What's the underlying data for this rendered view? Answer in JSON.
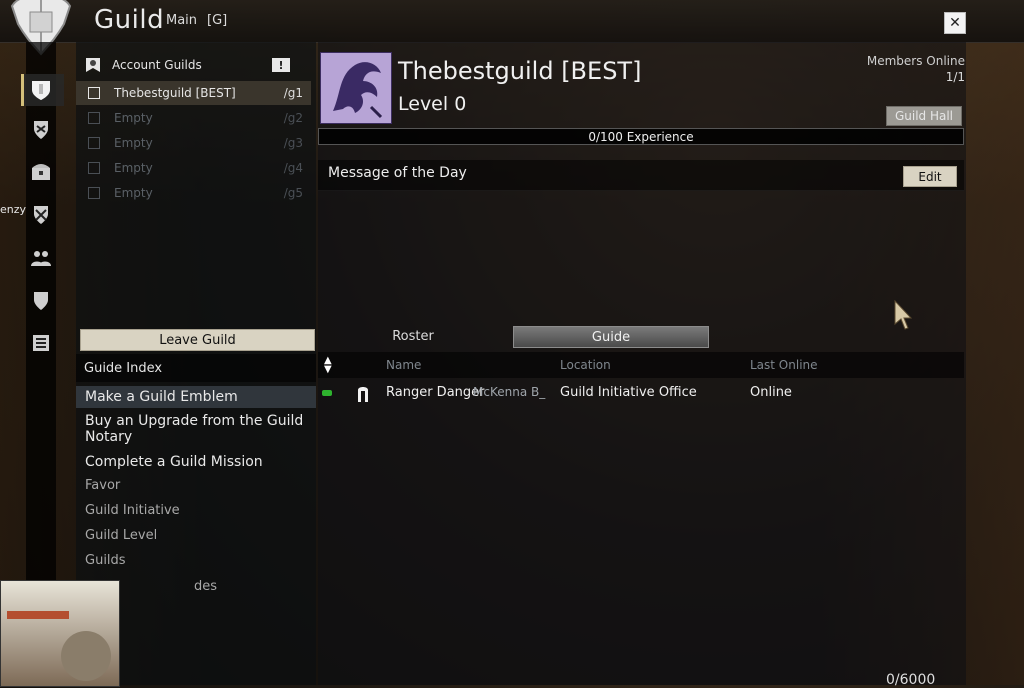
{
  "window": {
    "title": "Guild",
    "tabs": [
      "Main",
      "[G]"
    ]
  },
  "left_nav_icons": [
    "home-crest-icon",
    "shield-wings-icon",
    "treasure-chest-icon",
    "crossed-swords-shield-icon",
    "people-icon",
    "shield-icon",
    "list-icon"
  ],
  "account_guilds": {
    "header_label": "Account Guilds",
    "header_icon": "exclamation-flag-icon",
    "rows": [
      {
        "name": "Thebestguild [BEST]",
        "slot": "/g1",
        "selected": true,
        "empty": false
      },
      {
        "name": "Empty",
        "slot": "/g2",
        "selected": false,
        "empty": true
      },
      {
        "name": "Empty",
        "slot": "/g3",
        "selected": false,
        "empty": true
      },
      {
        "name": "Empty",
        "slot": "/g4",
        "selected": false,
        "empty": true
      },
      {
        "name": "Empty",
        "slot": "/g5",
        "selected": false,
        "empty": true
      }
    ],
    "leave_button": "Leave Guild"
  },
  "guide": {
    "index_label": "Guide Index",
    "items": [
      "Make a Guild Emblem",
      "Buy an Upgrade from the Guild Notary",
      "Complete a Guild Mission",
      "Favor",
      "Guild Initiative",
      "Guild Level",
      "Guilds",
      "des"
    ]
  },
  "guild": {
    "name": "Thebestguild [BEST]",
    "level": "Level 0",
    "members_online_label": "Members Online",
    "members_online_value": "1/1",
    "guild_hall_button": "Guild Hall",
    "experience_text": "0/100 Experience",
    "experience_fraction": 0.0
  },
  "motd": {
    "title": "Message of the Day",
    "edit_button": "Edit"
  },
  "tabs": {
    "roster": "Roster",
    "guide": "Guide"
  },
  "roster": {
    "columns": [
      "Name",
      "Location",
      "Last Online"
    ],
    "rows": [
      {
        "name": "Ranger Danger",
        "account": "McKenna B_",
        "location": "Guild Initiative Office",
        "last_online": "Online"
      }
    ]
  },
  "side_label": "enzy",
  "bottom_counter": "0/6000"
}
